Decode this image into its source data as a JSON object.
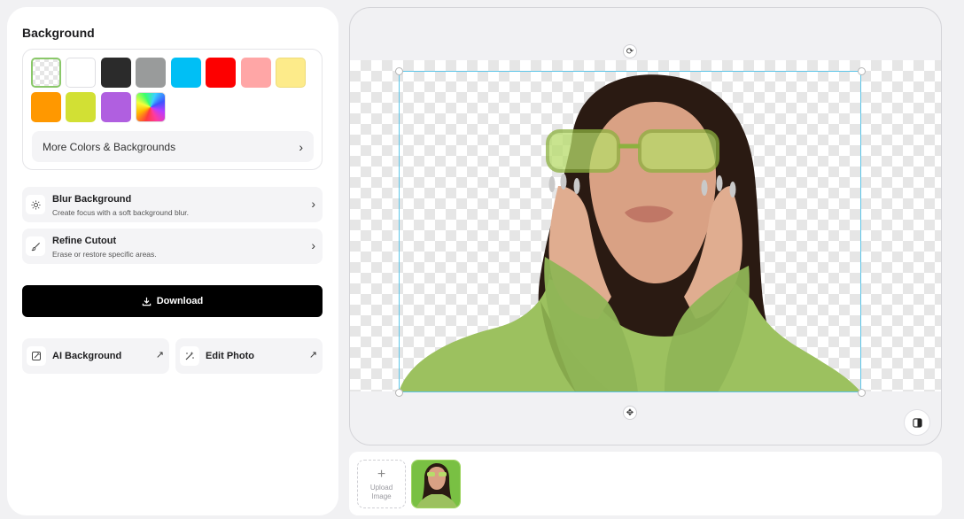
{
  "sidebar": {
    "background_title": "Background",
    "swatches": [
      {
        "name": "transparent",
        "color": "checker"
      },
      {
        "name": "white",
        "color": "#ffffff"
      },
      {
        "name": "dark",
        "color": "#2b2b2b"
      },
      {
        "name": "gray",
        "color": "#999b9b"
      },
      {
        "name": "sky",
        "color": "#00bff5"
      },
      {
        "name": "red",
        "color": "#fd0000"
      },
      {
        "name": "pink",
        "color": "#ffa6a6"
      },
      {
        "name": "yellow",
        "color": "#fdeb8a"
      },
      {
        "name": "orange",
        "color": "#ff9800"
      },
      {
        "name": "lime",
        "color": "#d2e034"
      },
      {
        "name": "purple",
        "color": "#b05fe0"
      },
      {
        "name": "gradient",
        "color": "rainbow"
      }
    ],
    "more_colors_label": "More Colors & Backgrounds",
    "blur": {
      "title": "Blur Background",
      "desc": "Create focus with a soft background blur."
    },
    "refine": {
      "title": "Refine Cutout",
      "desc": "Erase or restore specific areas."
    },
    "download_label": "Download",
    "ai_background_label": "AI Background",
    "edit_photo_label": "Edit Photo"
  },
  "upload": {
    "label_line1": "Upload",
    "label_line2": "Image"
  },
  "colors": {
    "accent_selection": "#5dc5e8",
    "primary_button": "#000000",
    "thumb_border": "#9dd45f"
  },
  "icons": {
    "rotate": "rotate-icon",
    "move": "move-icon",
    "compare": "compare-icon",
    "download": "download-icon",
    "blur": "sun-blur-icon",
    "refine": "brush-icon"
  }
}
